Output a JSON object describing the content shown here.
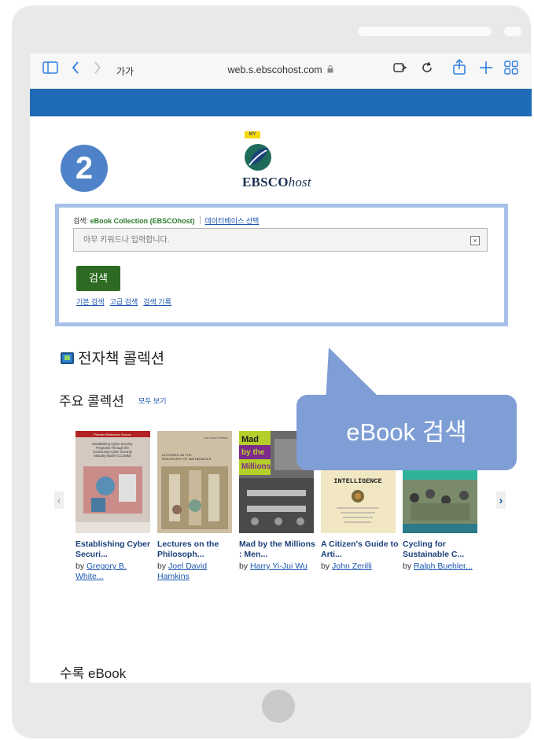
{
  "browser": {
    "text_size_label": "가가",
    "url": "web.s.ebscohost.com",
    "lock_glyph": "🔒"
  },
  "step_badge": "2",
  "logo": {
    "my_tag": "MY",
    "brand": "EBSCO",
    "brand_suffix": "host"
  },
  "search": {
    "scope_prefix": "검색: ",
    "database": "eBook Collection (EBSCOhost)",
    "choose_db_link": "데이터베이스 선택",
    "placeholder": "아무 키워드나 입력합니다.",
    "clear_glyph": "×",
    "submit_label": "검색",
    "links": [
      "기본 검색",
      "고급 검색",
      "검색 기록"
    ]
  },
  "callout_text": "eBook 검색",
  "sections": {
    "ebook_collection": "전자책 콜렉션",
    "major_collections": "주요 콜렉션",
    "view_all": "모두 보기",
    "included_ebooks": "수록 eBook"
  },
  "carousel": {
    "prev_glyph": "‹",
    "next_glyph": "›",
    "books": [
      {
        "title": "Establishing Cyber Securi...",
        "by": "by ",
        "author": "Gregory B. White...",
        "cover_text": "Premier Reference Source\nEstablishing Cyber Security Programs Through the Community Cyber Security Maturity Model (CCSMM)",
        "cover_colors": {
          "bg": "#d4c9c0",
          "band": "#b22222"
        }
      },
      {
        "title": "Lectures on the Philosoph...",
        "by": "by ",
        "author": "Joel David Hamkins",
        "cover_text": "LECTURES ON THE PHILOSOPHY OF MATHEMATICS",
        "cover_colors": {
          "bg": "#cdbfa6",
          "band": "#8c7a5f"
        }
      },
      {
        "title": "Mad by the Millions : Men...",
        "by": "by ",
        "author": "Harry Yi-Jui Wu",
        "cover_text": "Mad by the Millions",
        "cover_colors": {
          "bg": "#6a6a6a",
          "band": "#b5cf2a"
        }
      },
      {
        "title": "A Citizen's Guide to Arti...",
        "by": "by ",
        "author": "John Zerilli",
        "cover_text": "INTELLIGENCE",
        "cover_colors": {
          "bg": "#f2e7c3",
          "band": "#c08a3c"
        }
      },
      {
        "title": "Cycling for Sustainable C...",
        "by": "by ",
        "author": "Ralph Buehler...",
        "cover_text": "",
        "cover_colors": {
          "bg": "#5c8a7a",
          "band": "#2fb39a"
        }
      }
    ]
  },
  "colors": {
    "blue_bar": "#1f6bb5",
    "highlight_border": "#a8c0e8",
    "badge": "#4f82c8",
    "callout": "#7f9ed6",
    "search_button": "#2e6b22",
    "link": "#1a55b0"
  }
}
